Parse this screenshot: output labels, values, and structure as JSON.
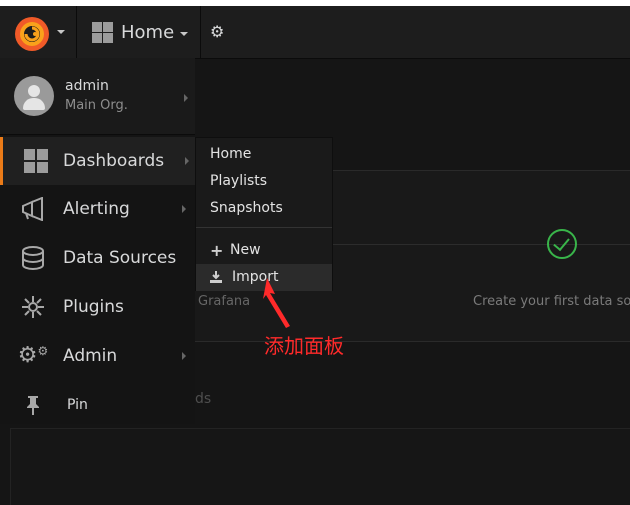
{
  "topbar": {
    "home_label": "Home",
    "icons": {
      "logo": "grafana-logo-icon",
      "settings": "gear-icon",
      "dashboards": "grid-icon"
    }
  },
  "profile": {
    "name": "admin",
    "org": "Main Org."
  },
  "sidebar": {
    "items": [
      {
        "label": "Dashboards",
        "icon": "dashboards-grid-icon"
      },
      {
        "label": "Alerting",
        "icon": "megaphone-icon"
      },
      {
        "label": "Data Sources",
        "icon": "database-icon"
      },
      {
        "label": "Plugins",
        "icon": "plugins-icon"
      },
      {
        "label": "Admin",
        "icon": "cogs-icon"
      },
      {
        "label": "Pin",
        "icon": "pin-icon"
      }
    ]
  },
  "submenu": {
    "items": [
      "Home",
      "Playlists",
      "Snapshots"
    ],
    "new_label": "New",
    "import_label": "Import"
  },
  "background": {
    "grafana_text": "Grafana",
    "create_text": "Create your first data so",
    "ds_text": "ds"
  },
  "annotation": {
    "text": "添加面板"
  },
  "colors": {
    "accent": "#eb7b18",
    "success": "#39b54a",
    "annotation": "#ff2a2a"
  }
}
